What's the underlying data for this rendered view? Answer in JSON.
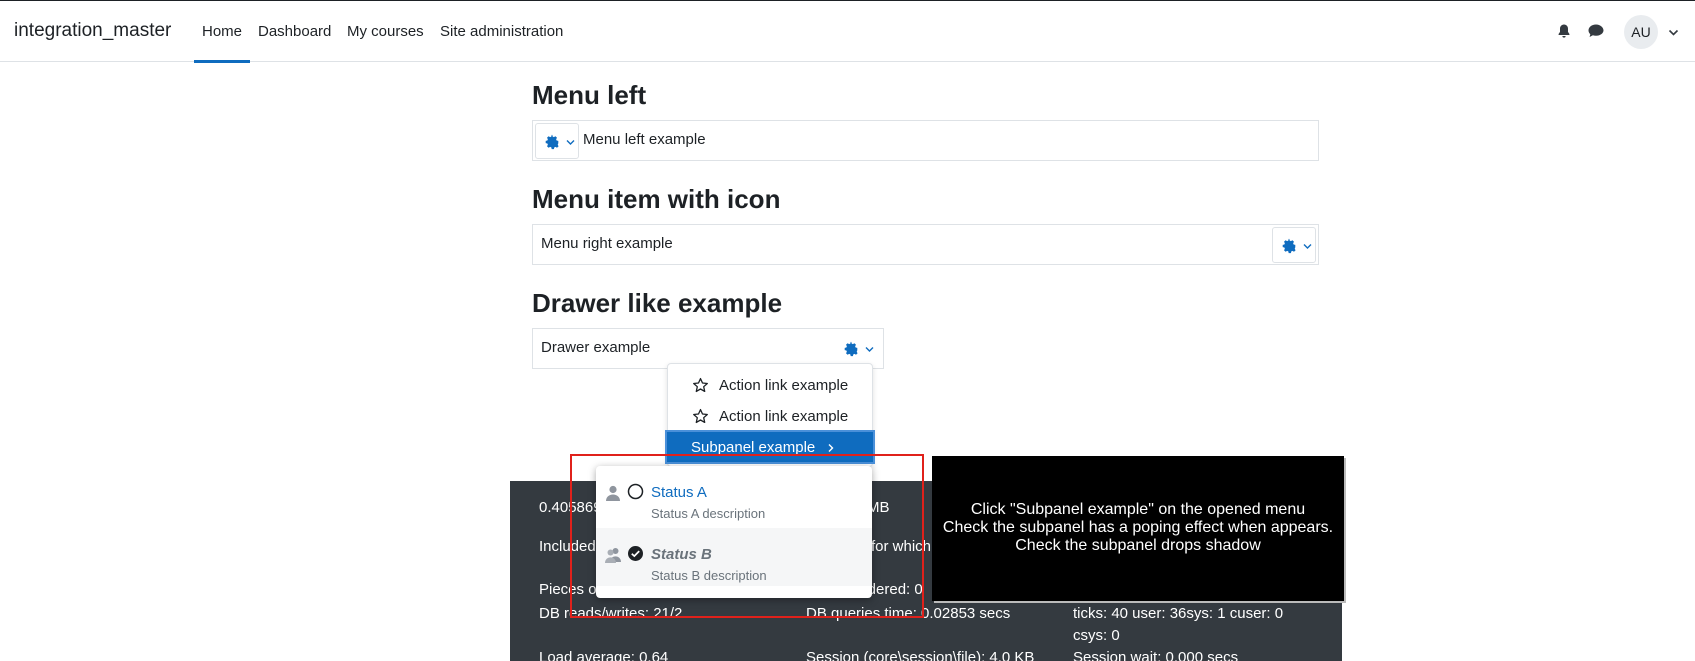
{
  "navbar": {
    "brand": "integration_master",
    "items": [
      {
        "label": "Home",
        "active": true
      },
      {
        "label": "Dashboard"
      },
      {
        "label": "My courses"
      },
      {
        "label": "Site administration"
      }
    ],
    "bell_icon": "bell-icon",
    "chat_icon": "chat-bubble-icon",
    "avatar": "AU"
  },
  "sections": {
    "menu_left": {
      "title": "Menu left",
      "text": "Menu left example"
    },
    "menu_icon": {
      "title": "Menu item with icon",
      "text": "Menu right example"
    },
    "drawer": {
      "title": "Drawer like example",
      "text": "Drawer example"
    }
  },
  "dropdown": {
    "items": [
      "Action link example",
      "Action link example"
    ],
    "subpanel_label": "Subpanel example"
  },
  "subpanel": {
    "statuses": [
      {
        "name": "Status A",
        "description": "Status A description",
        "selected": false
      },
      {
        "name": "Status B",
        "description": "Status B description",
        "selected": true
      }
    ]
  },
  "footer": {
    "row1_left": "0.405869",
    "row1_mid": "MB",
    "row2_left": "Included",
    "row2_mid": "for which",
    "row3_left": "Pieces o",
    "row3_mid": "filters rendered: 0",
    "row4_left": "DB reads/writes: 21/2",
    "row4_mid": "DB queries time: 0.02853 secs",
    "row4_right": "ticks: 40 user: 36sys: 1 cuser: 0",
    "row5_right": "csys: 0",
    "row6_left": "Load average: 0.64",
    "row6_mid": "Session (core\\session\\file): 4.0 KB",
    "row6_right": "Session wait: 0.000 secs"
  },
  "instructions": {
    "line1": "Click \"Subpanel example\"  on the opened menu",
    "line2": "Check the subpanel has a poping effect when appears.",
    "line3": "Check the subpanel drops shadow"
  },
  "colors": {
    "primary": "#0f6cbf",
    "footer_bg": "#343a40",
    "highlight_frame": "#e0211b"
  }
}
